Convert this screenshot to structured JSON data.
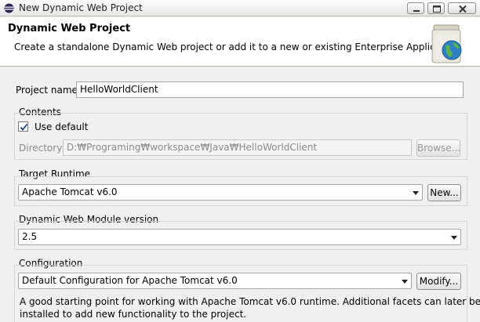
{
  "window": {
    "title": "New Dynamic Web Project"
  },
  "banner": {
    "heading": "Dynamic Web Project",
    "description": "Create a standalone Dynamic Web project or add it to a new or existing Enterprise Application."
  },
  "project_name": {
    "label": "Project name:",
    "value": "HelloWorldClient"
  },
  "contents": {
    "group_label": "Contents",
    "use_default_label": "Use default",
    "use_default_checked": true,
    "directory_label": "Directory:",
    "directory_value": "D:₩Programing₩workspace₩Java₩HelloWorldClient",
    "browse_label": "Browse..."
  },
  "target_runtime": {
    "group_label": "Target Runtime",
    "selected": "Apache Tomcat v6.0",
    "new_label": "New..."
  },
  "web_module": {
    "group_label": "Dynamic Web Module version",
    "selected": "2.5"
  },
  "configuration": {
    "group_label": "Configuration",
    "selected": "Default Configuration for Apache Tomcat v6.0",
    "modify_label": "Modify...",
    "description_line1": "A good starting point for working with Apache Tomcat v6.0 runtime. Additional facets can later be",
    "description_line2": "installed to add new functionality to the project."
  },
  "icons": {
    "app": "eclipse-icon",
    "banner": "web-project-jar-icon",
    "minimize": "minimize-icon",
    "maximize": "maximize-icon",
    "close": "close-icon",
    "dropdown": "chevron-down-icon",
    "check": "checkmark-icon"
  }
}
